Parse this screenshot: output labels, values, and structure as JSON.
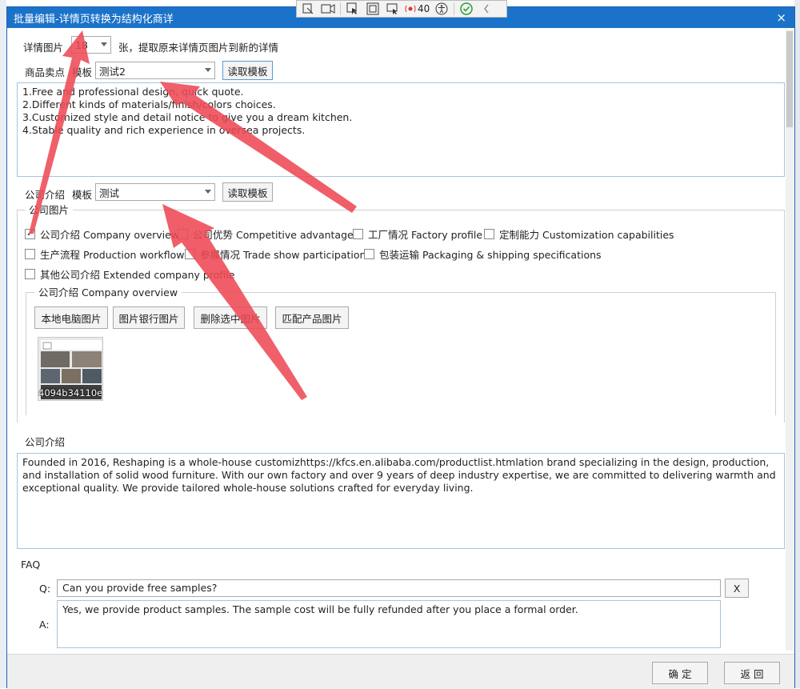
{
  "toolbar": {
    "icons": [
      "edit-frame-icon",
      "video-icon",
      "select-cursor-icon",
      "fullscreen-icon",
      "window-cursor-icon",
      "record-icon",
      "accessibility-icon",
      "check-icon",
      "chevron-left-icon"
    ],
    "count": "40"
  },
  "dialog": {
    "title": "批量编辑-详情页转换为结构化商详",
    "close": "×"
  },
  "detail_images": {
    "label": "详情图片",
    "count_value": "18",
    "suffix": "张，提取原来详情页图片到新的详情"
  },
  "selling_points": {
    "label": "商品卖点",
    "template_label": "模板",
    "template_value": "测试2",
    "read_button": "读取模板",
    "text": "1.Free and professional design, quick quote.\n2.Different kinds of materials/finish/colors choices.\n3.Customized style and detail notice to give you a dream kitchen.\n4.Stable quality and rich experience in oversea projects."
  },
  "company_intro": {
    "label": "公司介绍",
    "template_label": "模板",
    "template_value": "测试",
    "read_button": "读取模板"
  },
  "company_images": {
    "legend": "公司图片",
    "checkboxes": [
      {
        "label": "公司介绍 Company overview",
        "checked": true
      },
      {
        "label": "公司优势 Competitive advantages",
        "checked": false
      },
      {
        "label": "工厂情况 Factory profile",
        "checked": false
      },
      {
        "label": "定制能力 Customization capabilities",
        "checked": false
      },
      {
        "label": "生产流程 Production workflow",
        "checked": false
      },
      {
        "label": "参展情况 Trade show participation",
        "checked": false
      },
      {
        "label": "包装运输 Packaging & shipping specifications",
        "checked": false
      },
      {
        "label": "其他公司介绍 Extended company profile",
        "checked": false
      }
    ],
    "sub_legend": "公司介绍 Company overview",
    "buttons": [
      "本地电脑图片",
      "图片银行图片",
      "删除选中图片",
      "匹配产品图片"
    ],
    "thumb_caption": "4094b34110e"
  },
  "company_text": {
    "label": "公司介绍",
    "text": "Founded in 2016, Reshaping is a whole-house customizhttps://kfcs.en.alibaba.com/productlist.htmlation brand specializing in the design, production, and installation of solid wood furniture. With our own factory and over 9 years of deep industry expertise, we are committed to delivering warmth and exceptional quality. We provide tailored whole-house solutions crafted for everyday living."
  },
  "faq": {
    "label": "FAQ",
    "q_label": "Q:",
    "a_label": "A:",
    "question": "Can you provide free samples?",
    "answer": "Yes, we provide product samples. The sample cost will be fully refunded after you place a formal order.",
    "remove": "X"
  },
  "footer": {
    "confirm": "确 定",
    "back": "返 回"
  },
  "colors": {
    "title_bar": "#1b72c9",
    "annotation_arrow": "#ee4a55"
  }
}
